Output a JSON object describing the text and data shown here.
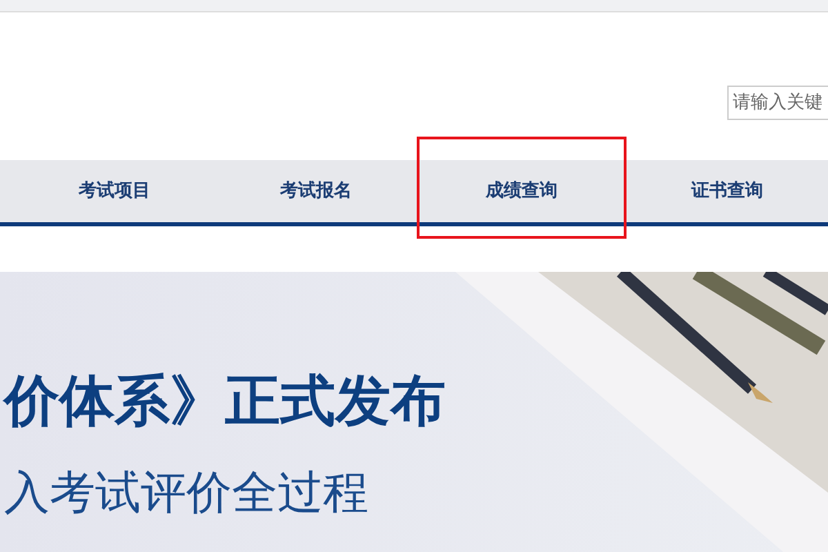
{
  "search": {
    "placeholder": "请输入关键"
  },
  "nav": [
    {
      "label": "考试项目",
      "selected": false
    },
    {
      "label": "考试报名",
      "selected": false
    },
    {
      "label": "成绩查询",
      "selected": true
    },
    {
      "label": "证书查询",
      "selected": false
    }
  ],
  "banner": {
    "headline": "价体系》正式发布",
    "subline": "入考试评价全过程"
  }
}
